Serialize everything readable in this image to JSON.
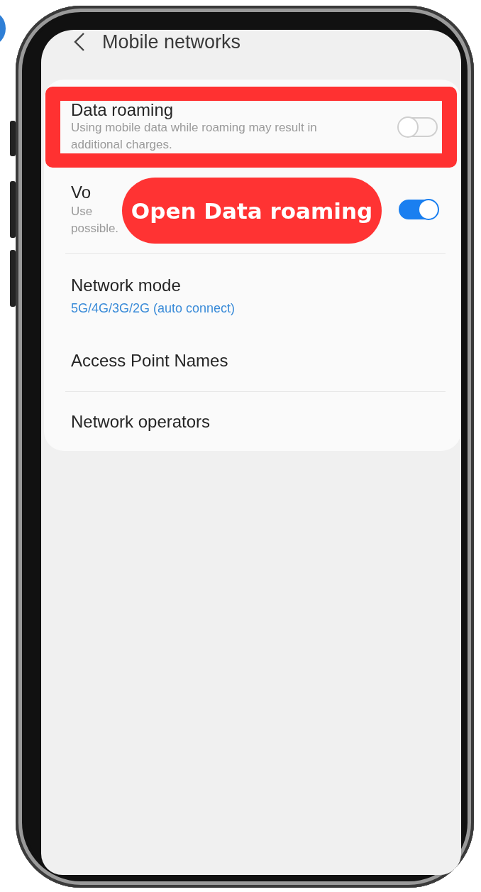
{
  "screen": {
    "title": "Mobile networks"
  },
  "settings": [
    {
      "kind": "toggle",
      "title": "Data roaming",
      "description_lines": [
        "Using mobile data while roaming may result in",
        "additional charges."
      ],
      "on": false,
      "highlighted": true,
      "divider_after": false
    },
    {
      "kind": "toggle",
      "title": "Vo",
      "description_lines": [
        "Use",
        "possible."
      ],
      "on": true,
      "highlighted": false,
      "divider_after": true
    },
    {
      "kind": "link",
      "title": "Network mode",
      "value": "5G/4G/3G/2G (auto connect)",
      "highlighted": false,
      "divider_after": false
    },
    {
      "kind": "link",
      "title": "Access Point Names",
      "highlighted": false,
      "divider_after": true
    },
    {
      "kind": "link",
      "title": "Network operators",
      "highlighted": false,
      "divider_after": false
    }
  ],
  "callout": {
    "text": "Open Data roaming"
  }
}
